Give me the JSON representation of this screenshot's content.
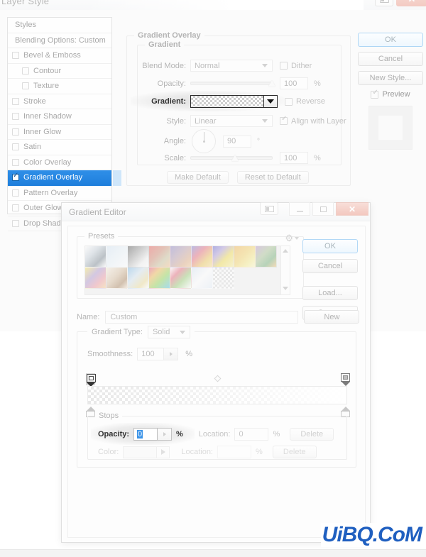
{
  "layer_style_window": {
    "title": "Layer Style",
    "window_controls": {
      "panel_icon": "panel-icon",
      "close_label": "✕"
    },
    "styles_list": {
      "header": "Styles",
      "blending_options": "Blending Options: Custom",
      "items": [
        {
          "label": "Bevel & Emboss",
          "checked": false,
          "indent": false,
          "selected": false
        },
        {
          "label": "Contour",
          "checked": false,
          "indent": true,
          "selected": false
        },
        {
          "label": "Texture",
          "checked": false,
          "indent": true,
          "selected": false
        },
        {
          "label": "Stroke",
          "checked": false,
          "indent": false,
          "selected": false
        },
        {
          "label": "Inner Shadow",
          "checked": false,
          "indent": false,
          "selected": false
        },
        {
          "label": "Inner Glow",
          "checked": false,
          "indent": false,
          "selected": false
        },
        {
          "label": "Satin",
          "checked": false,
          "indent": false,
          "selected": false
        },
        {
          "label": "Color Overlay",
          "checked": false,
          "indent": false,
          "selected": false
        },
        {
          "label": "Gradient Overlay",
          "checked": true,
          "indent": false,
          "selected": true
        },
        {
          "label": "Pattern Overlay",
          "checked": false,
          "indent": false,
          "selected": false
        },
        {
          "label": "Outer Glow",
          "checked": false,
          "indent": false,
          "selected": false
        },
        {
          "label": "Drop Shadow",
          "checked": false,
          "indent": false,
          "selected": false
        }
      ]
    },
    "buttons": {
      "ok": "OK",
      "cancel": "Cancel",
      "new_style": "New Style...",
      "preview": "Preview",
      "preview_checked": true
    },
    "gradient_overlay": {
      "group_title": "Gradient Overlay",
      "subgroup_title": "Gradient",
      "blend_mode_label": "Blend Mode:",
      "blend_mode_value": "Normal",
      "dither_label": "Dither",
      "dither_checked": false,
      "opacity_label": "Opacity:",
      "opacity_value": "100",
      "opacity_unit": "%",
      "gradient_label": "Gradient:",
      "gradient_swatch": "transparent-checkerboard",
      "reverse_label": "Reverse",
      "reverse_checked": false,
      "style_label": "Style:",
      "style_value": "Linear",
      "align_label": "Align with Layer",
      "align_checked": true,
      "angle_label": "Angle:",
      "angle_value": "90",
      "angle_unit": "°",
      "scale_label": "Scale:",
      "scale_value": "100",
      "scale_unit": "%",
      "make_default": "Make Default",
      "reset_to_default": "Reset to Default"
    }
  },
  "gradient_editor": {
    "title": "Gradient Editor",
    "window_controls": {
      "panel_icon": "panel-icon",
      "minimize": "minimize-icon",
      "maximize": "maximize-icon",
      "close": "✕"
    },
    "presets": {
      "legend": "Presets",
      "gear_icon": "gear-icon",
      "swatches": [
        "linear-gradient(135deg,#ffffff 0%,#cfd8e0 35%,#8f9aa3 70%,#ffffff 100%)",
        "linear-gradient(135deg,#dceaf7 0%,#eef6fc 50%,#ffffff 100%)",
        "linear-gradient(135deg,#6e6e6e 0%,#bdbdbd 45%,#f2f2f2 75%,#ffffff 100%)",
        "linear-gradient(135deg,#e8736f 0%,#d79a86 40%,#cfc9a8 70%,#f5c79a 100%)",
        "linear-gradient(135deg,#9a93c9 0%,#c0a9b8 40%,#e2b796 75%,#f3cda2 100%)",
        "linear-gradient(135deg,#8f8fd6 0%,#e87f8f 35%,#f0cf72 70%,#f7e2a4 100%)",
        "linear-gradient(135deg,#7a7ad4 0%,#b9a9dd 30%,#f2e06a 60%,#f8f0b0 100%)",
        "linear-gradient(135deg,#f3c06a 0%,#f6d97e 45%,#f8ef9d 75%,#fdf8cd 100%)",
        "linear-gradient(135deg,#c3a5cf 0%,#b6cba4 40%,#86b98a 70%,#f3c88c 100%)",
        "linear-gradient(135deg,#f5e77a 0%,#b9a5d6 40%,#f0a6ae 70%,#f6d6a0 100%)",
        "linear-gradient(135deg,#f7efe3 0%,#ddc7ad 45%,#b79878 75%,#f3e6d6 100%)",
        "linear-gradient(135deg,#8fc2e8 0%,#d9e7f2 40%,#efe1a8 75%,#ffffff 100%)",
        "linear-gradient(135deg,#e86a8a 0%,#f0c36a 30%,#9fd96a 60%,#6ac9e8 100%)",
        "linear-gradient(135deg,#ffffff 0%,#e87f8f 30%,#a8d48a 60%,#ffffff 100%)",
        "linear-gradient(135deg,#dfeaf7 0%,#ffffff 50%,#e8f0fa 100%)",
        "checkerboard"
      ]
    },
    "buttons": {
      "ok": "OK",
      "cancel": "Cancel",
      "load": "Load...",
      "save": "Save...",
      "new": "New"
    },
    "name_label": "Name:",
    "name_value": "Custom",
    "gradient_type_label": "Gradient Type:",
    "gradient_type_value": "Solid",
    "smoothness_label": "Smoothness:",
    "smoothness_value": "100",
    "smoothness_unit": "%",
    "gradient_bar": "transparent-to-white",
    "stops": {
      "legend": "Stops",
      "opacity_label": "Opacity:",
      "opacity_value": "0",
      "opacity_unit": "%",
      "opacity_location_label": "Location:",
      "opacity_location_value": "0",
      "opacity_location_unit": "%",
      "opacity_delete": "Delete",
      "color_label": "Color:",
      "color_location_label": "Location:",
      "color_location_value": "",
      "color_location_unit": "%",
      "color_delete": "Delete"
    }
  },
  "watermark": {
    "text": "UiBQ.CoM",
    "color": "#1f5fc0"
  },
  "colors": {
    "selection_blue": "#1f7fdc",
    "selection_tail": "#cfe6fa",
    "accent_blue": "#3a93e8",
    "close_red": "#f3bdb2"
  }
}
